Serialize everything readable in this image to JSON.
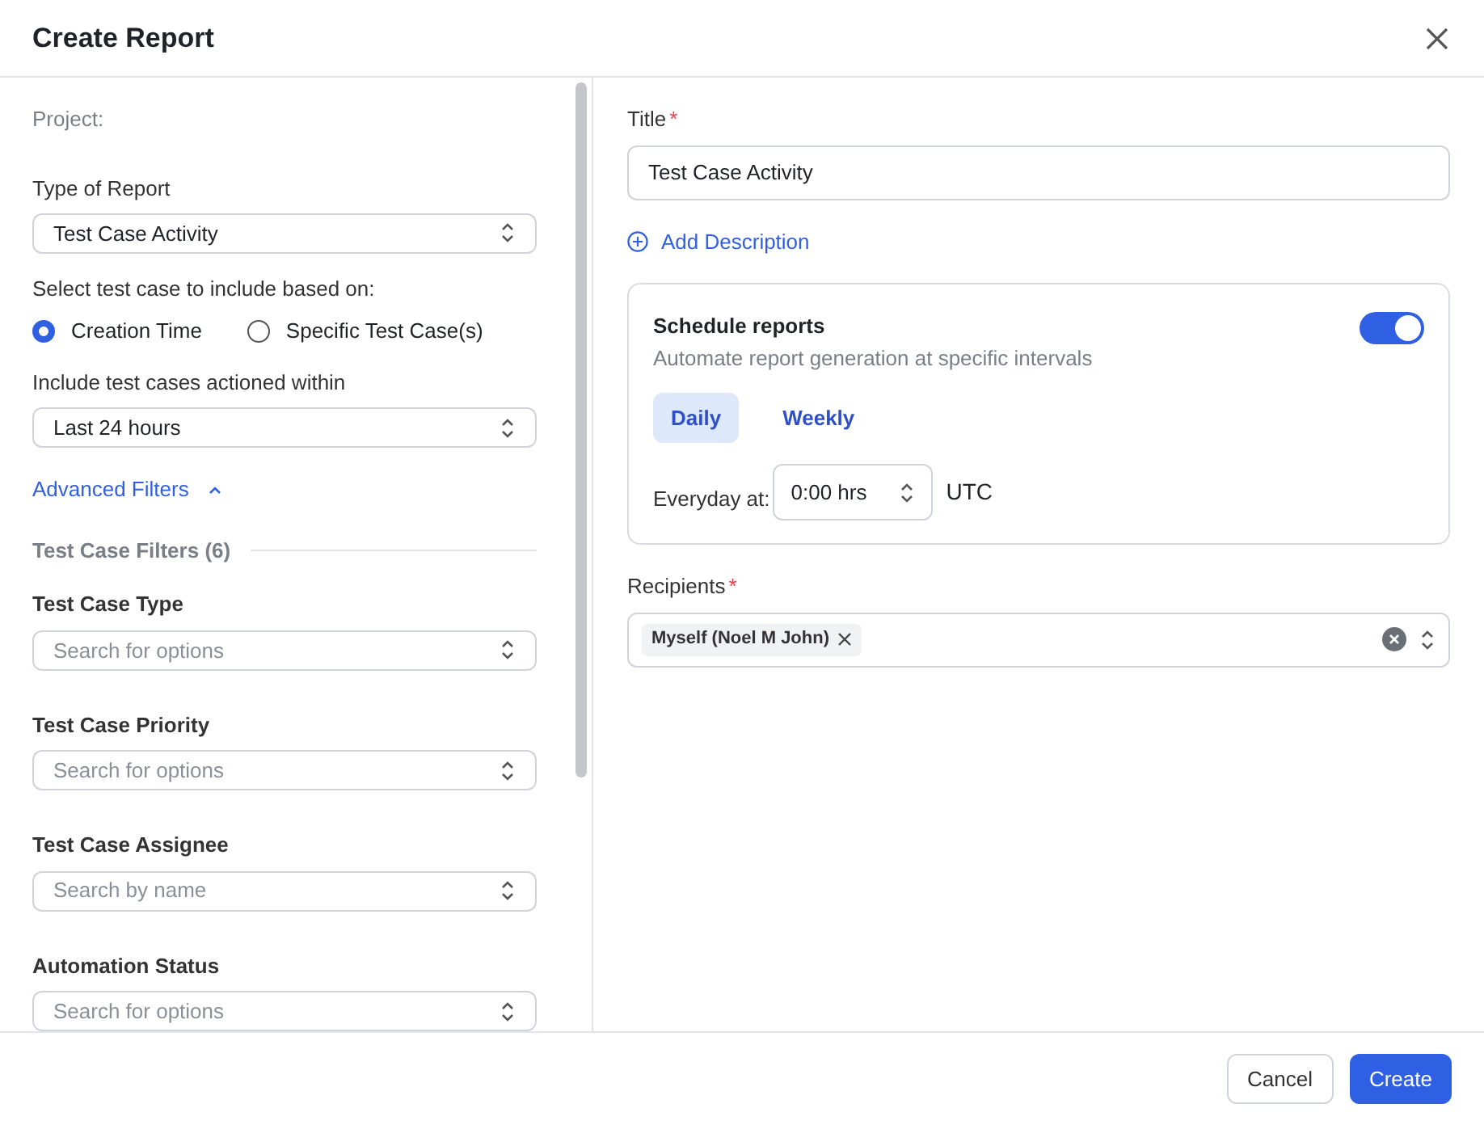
{
  "window": {
    "title": "Create Report"
  },
  "left": {
    "project_label": "Project:",
    "report_type": {
      "label": "Type of Report",
      "value": "Test Case Activity"
    },
    "basis": {
      "label": "Select test case to include based on:",
      "options": [
        {
          "label": "Creation Time",
          "selected": true
        },
        {
          "label": "Specific Test Case(s)",
          "selected": false
        }
      ]
    },
    "within": {
      "label": "Include test cases actioned within",
      "value": "Last 24 hours"
    },
    "advanced": {
      "label": "Advanced Filters",
      "expanded": true
    },
    "filters_heading": "Test Case Filters (6)",
    "filters": [
      {
        "label": "Test Case Type",
        "placeholder": "Search for options"
      },
      {
        "label": "Test Case Priority",
        "placeholder": "Search for options"
      },
      {
        "label": "Test Case Assignee",
        "placeholder": "Search by name"
      },
      {
        "label": "Automation Status",
        "placeholder": "Search for options"
      }
    ]
  },
  "right": {
    "title": {
      "label": "Title",
      "required_mark": "*",
      "value": "Test Case Activity"
    },
    "add_description": "Add Description",
    "schedule": {
      "title": "Schedule reports",
      "subtitle": "Automate report generation at specific intervals",
      "on": true,
      "tabs": [
        {
          "label": "Daily",
          "selected": true
        },
        {
          "label": "Weekly",
          "selected": false
        }
      ],
      "time_label": "Everyday at:",
      "time_value": "0:00 hrs",
      "timezone": "UTC"
    },
    "recipients": {
      "label": "Recipients",
      "required_mark": "*",
      "chips": [
        "Myself (Noel M John)"
      ]
    }
  },
  "buttons": [
    {
      "label": "Cancel",
      "kind": "secondary"
    },
    {
      "label": "Create",
      "kind": "primary"
    }
  ]
}
